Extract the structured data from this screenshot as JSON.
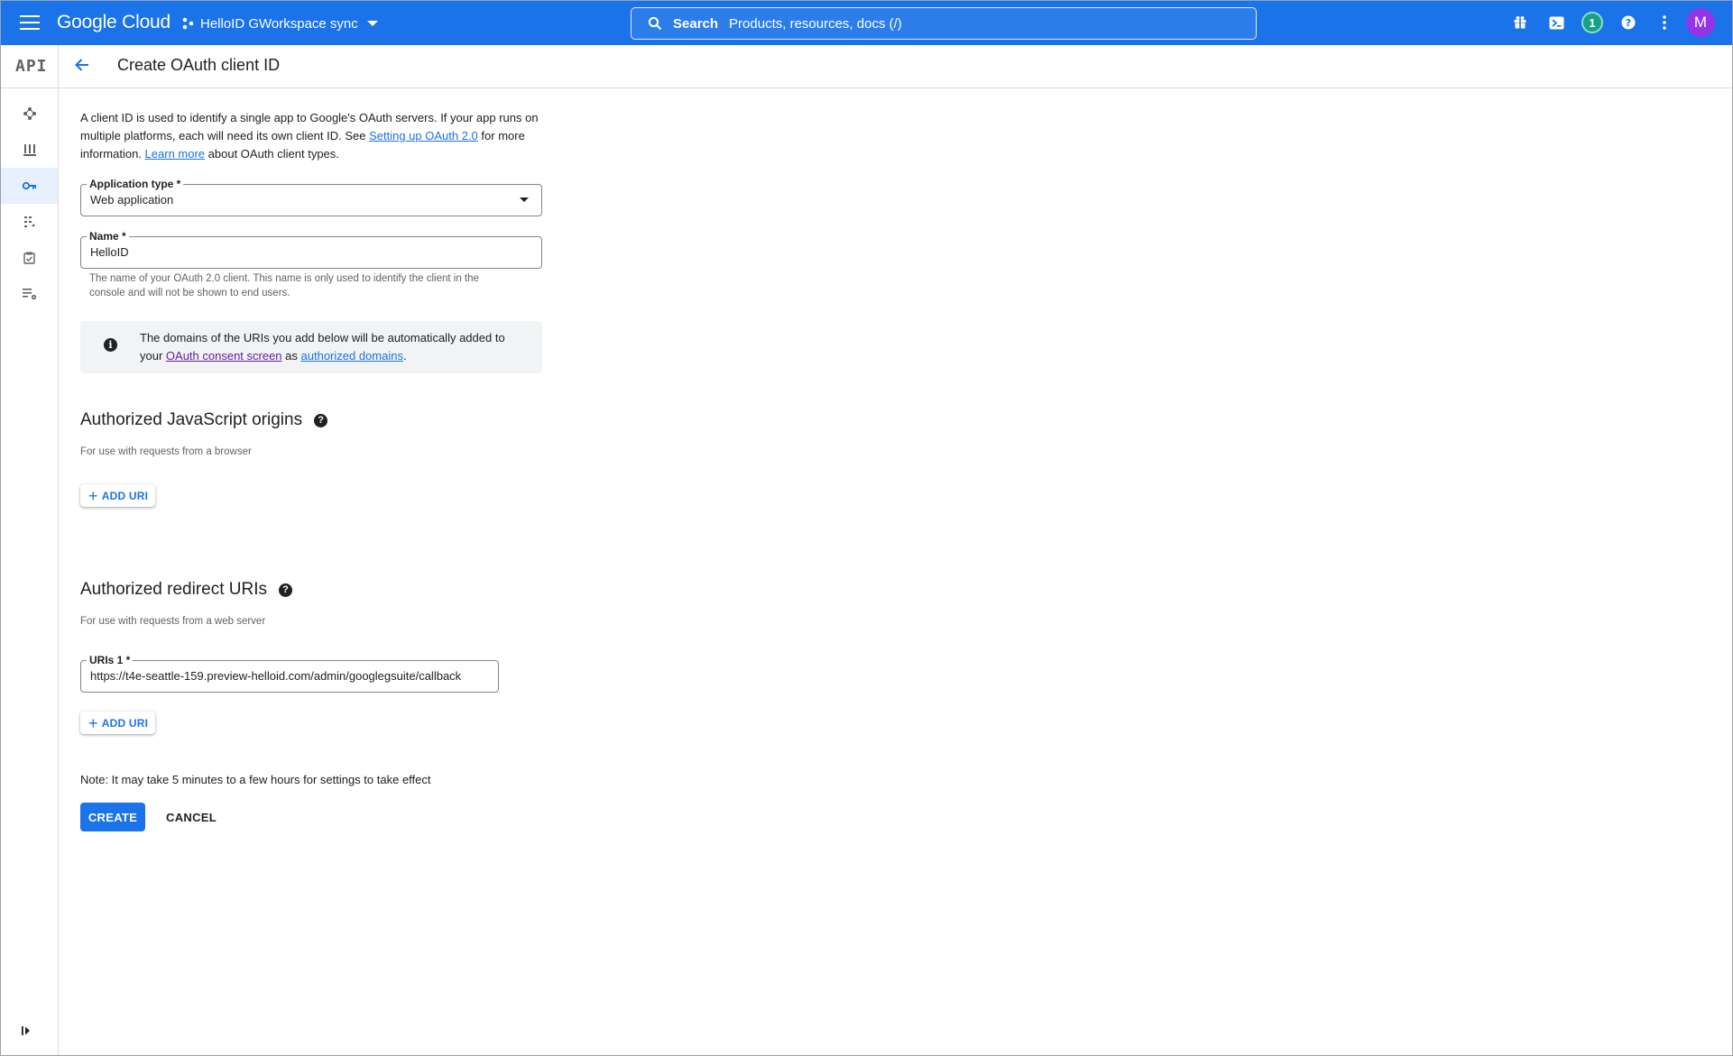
{
  "colors": {
    "topbar": "#1a73e8",
    "link": "#1a73e8",
    "visited_link": "#681da8",
    "avatar": "#9334e6",
    "notification": "#16a085"
  },
  "topbar": {
    "brand": "Google Cloud",
    "project": "HelloID GWorkspace sync",
    "search_label": "Search",
    "search_placeholder": "Products, resources, docs (/)",
    "notification_count": "1",
    "avatar_letter": "M",
    "icons": [
      "menu-icon",
      "project-icon",
      "search-icon",
      "gift-icon",
      "cloud-shell-icon",
      "help-icon",
      "more-vert-icon"
    ]
  },
  "rail": {
    "logo": "API",
    "items": [
      "dashboard-icon",
      "library-icon",
      "credentials-icon",
      "consent-icon",
      "agreements-icon",
      "settings-icon"
    ],
    "active_index": 2,
    "expand_icon": "expand-icon"
  },
  "header": {
    "title": "Create OAuth client ID"
  },
  "intro": {
    "part1": "A client ID is used to identify a single app to Google's OAuth servers. If your app runs on multiple platforms, each will need its own client ID. See ",
    "link1": "Setting up OAuth 2.0",
    "part2": " for more information. ",
    "link2": "Learn more",
    "part3": " about OAuth client types."
  },
  "app_type": {
    "label": "Application type *",
    "value": "Web application"
  },
  "name": {
    "label": "Name *",
    "value": "HelloID",
    "hint": "The name of your OAuth 2.0 client. This name is only used to identify the client in the console and will not be shown to end users."
  },
  "info": {
    "part1": "The domains of the URIs you add below will be automatically added to your ",
    "link1": "OAuth consent screen",
    "part2": " as ",
    "link2": "authorized domains",
    "part3": "."
  },
  "js_origins": {
    "title": "Authorized JavaScript origins",
    "subtitle": "For use with requests from a browser",
    "add_label": "ADD URI"
  },
  "redirect_uris": {
    "title": "Authorized redirect URIs",
    "subtitle": "For use with requests from a web server",
    "uri_label": "URIs 1 *",
    "uri_value": "https://t4e-seattle-159.preview-helloid.com/admin/googlegsuite/callback",
    "add_label": "ADD URI"
  },
  "note": "Note: It may take 5 minutes to a few hours for settings to take effect",
  "actions": {
    "create": "CREATE",
    "cancel": "CANCEL"
  }
}
